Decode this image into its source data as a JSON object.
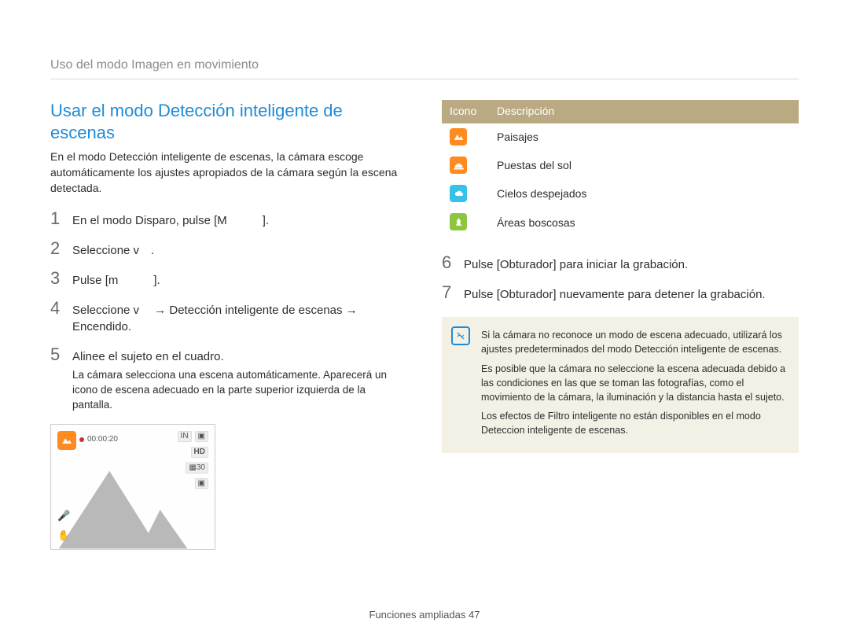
{
  "breadcrumb": "Uso del modo Imagen en movimiento",
  "heading": "Usar el modo Detección inteligente de escenas",
  "intro": "En el modo Detección inteligente de escenas, la cámara escoge automáticamente los ajustes apropiados de la cámara según la escena detectada.",
  "steps_left": [
    {
      "n": "1",
      "text": "En el modo Disparo, pulse [M   ]."
    },
    {
      "n": "2",
      "text": "Seleccione v ."
    },
    {
      "n": "3",
      "text": "Pulse [m   ]."
    },
    {
      "n": "4",
      "text": "Seleccione v  →  Detección inteligente de escenas → Encendido."
    },
    {
      "n": "5",
      "text": "Alinee el sujeto en el cuadro.",
      "sub": "La cámara selecciona una escena automáticamente. Aparecerá un icono de escena adecuado en la parte superior izquierda de la pantalla."
    }
  ],
  "preview": {
    "timer": "00:00:20",
    "right_labels": [
      "IN",
      "▣"
    ],
    "hd": "HD",
    "badge1": "▦30",
    "badge2": "▣"
  },
  "icon_table": {
    "headers": {
      "icon": "Icono",
      "desc": "Descripción"
    },
    "rows": [
      {
        "id": "landscape",
        "bg": "#ff8a1f",
        "label": "Paisajes"
      },
      {
        "id": "sunset",
        "bg": "#ff8a1f",
        "label": "Puestas del sol"
      },
      {
        "id": "sky",
        "bg": "#35c2e8",
        "label": "Cielos despejados"
      },
      {
        "id": "forest",
        "bg": "#8cc63f",
        "label": "Áreas boscosas"
      }
    ]
  },
  "steps_right": [
    {
      "n": "6",
      "text": "Pulse [Obturador] para iniciar la grabación."
    },
    {
      "n": "7",
      "text": "Pulse [Obturador] nuevamente para detener la grabación."
    }
  ],
  "note": [
    "Si la cámara no reconoce un modo de escena adecuado, utilizará los ajustes predeterminados del modo Detección inteligente de escenas.",
    "Es posible que la cámara no seleccione la escena adecuada debido a las condiciones en las que se toman las fotografías, como el movimiento de la cámara, la iluminación y la distancia hasta el sujeto.",
    "Los efectos de Filtro inteligente no están disponibles en el modo Deteccion inteligente de escenas."
  ],
  "footer": {
    "label": "Funciones ampliadas",
    "page": "47"
  }
}
